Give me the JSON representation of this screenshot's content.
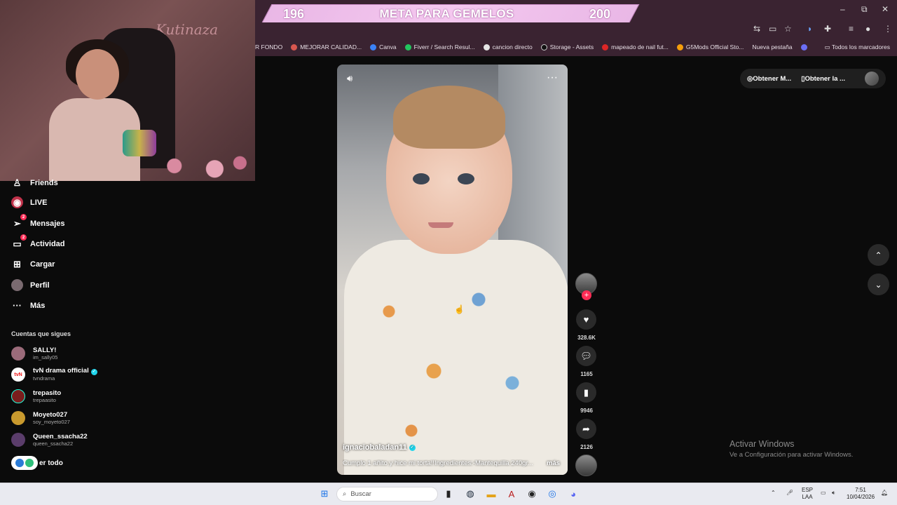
{
  "goal": {
    "current": "196",
    "title": "META PARA GEMELOS",
    "target": "200"
  },
  "window_controls": [
    "–",
    "⧉",
    "✕"
  ],
  "bookmarks": [
    {
      "label": "R FONDO",
      "color": ""
    },
    {
      "label": "MEJORAR CALIDAD...",
      "color": "#d9574f"
    },
    {
      "label": "Canva",
      "color": "#3b82f6"
    },
    {
      "label": "Fiverr / Search Resul...",
      "color": "#22c55e"
    },
    {
      "label": "cancion directo",
      "color": "#e5e5e5"
    },
    {
      "label": "Storage - Assets",
      "color": "#333333"
    },
    {
      "label": "mapeado de nail fut...",
      "color": "#dc2626"
    },
    {
      "label": "G5Mods Official Sto...",
      "color": "#f59e0b"
    },
    {
      "label": "Nueva pestaña",
      "color": ""
    }
  ],
  "bookmarks_all": "Todos los marcadores",
  "webcam_sign": "Kutinaza",
  "nav": [
    {
      "label": "Friends",
      "icon": "friends-icon",
      "glyph": "♙",
      "badge": ""
    },
    {
      "label": "LIVE",
      "icon": "live-icon",
      "glyph": "◉",
      "badge": ""
    },
    {
      "label": "Mensajes",
      "icon": "messages-icon",
      "glyph": "➢",
      "badge": "2"
    },
    {
      "label": "Actividad",
      "icon": "activity-icon",
      "glyph": "▭",
      "badge": "2"
    },
    {
      "label": "Cargar",
      "icon": "upload-icon",
      "glyph": "⊞",
      "badge": ""
    },
    {
      "label": "Perfil",
      "icon": "profile-icon",
      "glyph": "●",
      "badge": ""
    },
    {
      "label": "Más",
      "icon": "more-icon",
      "glyph": "···",
      "badge": ""
    }
  ],
  "following_title": "Cuentas que sigues",
  "accounts": [
    {
      "name": "SALLY!",
      "handle": "im_sally05",
      "verified": false,
      "color": "#9b6b7a"
    },
    {
      "name": "tvN drama official",
      "handle": "tvndrama",
      "verified": true,
      "color": "#ffffff"
    },
    {
      "name": "trepasito",
      "handle": "trepaasito",
      "verified": false,
      "color": "#7a1d1d"
    },
    {
      "name": "Moyeto027",
      "handle": "soy_moyeto027",
      "verified": false,
      "color": "#c99a2e"
    },
    {
      "name": "Queen_ssacha22",
      "handle": "queen_ssacha22",
      "verified": false,
      "color": "#5b3d6b"
    }
  ],
  "see_all": "Ver todo",
  "see_all_visible": "er todo",
  "video": {
    "author": "ignaciobaladan11",
    "caption": "Cumplo 1 añito y hice mi torta!!Ingredientes:-Mantequilla 240gr...",
    "more": "más"
  },
  "actions": {
    "likes": "328.6K",
    "comments": "1165",
    "saves": "9946",
    "shares": "2126"
  },
  "top_buttons": {
    "coins": "Obtener M...",
    "app": "Obtener la ..."
  },
  "watermark": {
    "line1": "Activar Windows",
    "line2": "Ve a Configuración para activar Windows."
  },
  "taskbar": {
    "search": "Buscar",
    "lang1": "ESP",
    "lang2": "LAA",
    "time": "7:51",
    "date": "10/04/2026"
  }
}
